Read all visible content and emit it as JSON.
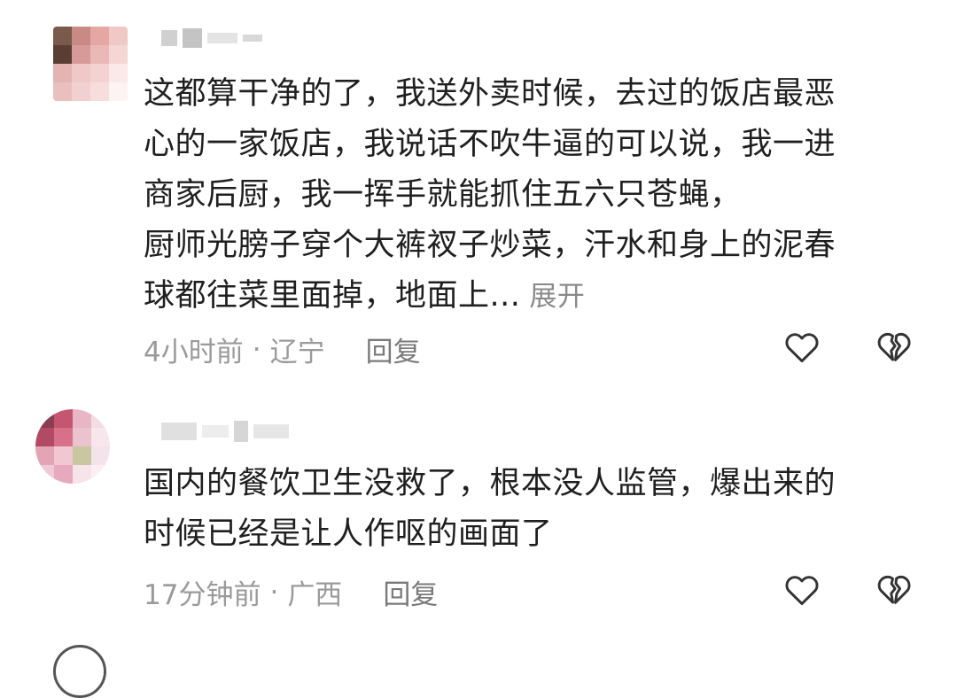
{
  "comments": [
    {
      "lines": [
        "这都算干净的了，我送外卖时候，去过的饭店最恶",
        "心的一家饭店，我说话不吹牛逼的可以说，我一进",
        "商家后厨，我一挥手就能抓住五六只苍蝇，",
        "厨师光膀子穿个大裤衩子炒菜，汗水和身上的泥春",
        "球都往菜里面掉，地面上..."
      ],
      "expand_label": "展开",
      "time": "4小时前",
      "separator": "·",
      "location": "辽宁",
      "reply_label": "回复",
      "avatar": "pixelated-avatar",
      "like_icon": "heart-outline-icon",
      "dislike_icon": "broken-heart-icon"
    },
    {
      "lines": [
        "国内的餐饮卫生没救了，根本没人监管，爆出来的",
        "时候已经是让人作呕的画面了"
      ],
      "time": "17分钟前",
      "separator": "·",
      "location": "广西",
      "reply_label": "回复",
      "avatar": "pixelated-avatar",
      "like_icon": "heart-outline-icon",
      "dislike_icon": "broken-heart-icon"
    }
  ],
  "colors": {
    "text": "#1f1f1f",
    "meta": "#9a9a9a",
    "expand": "#8a8a8a",
    "icon": "#333333"
  }
}
